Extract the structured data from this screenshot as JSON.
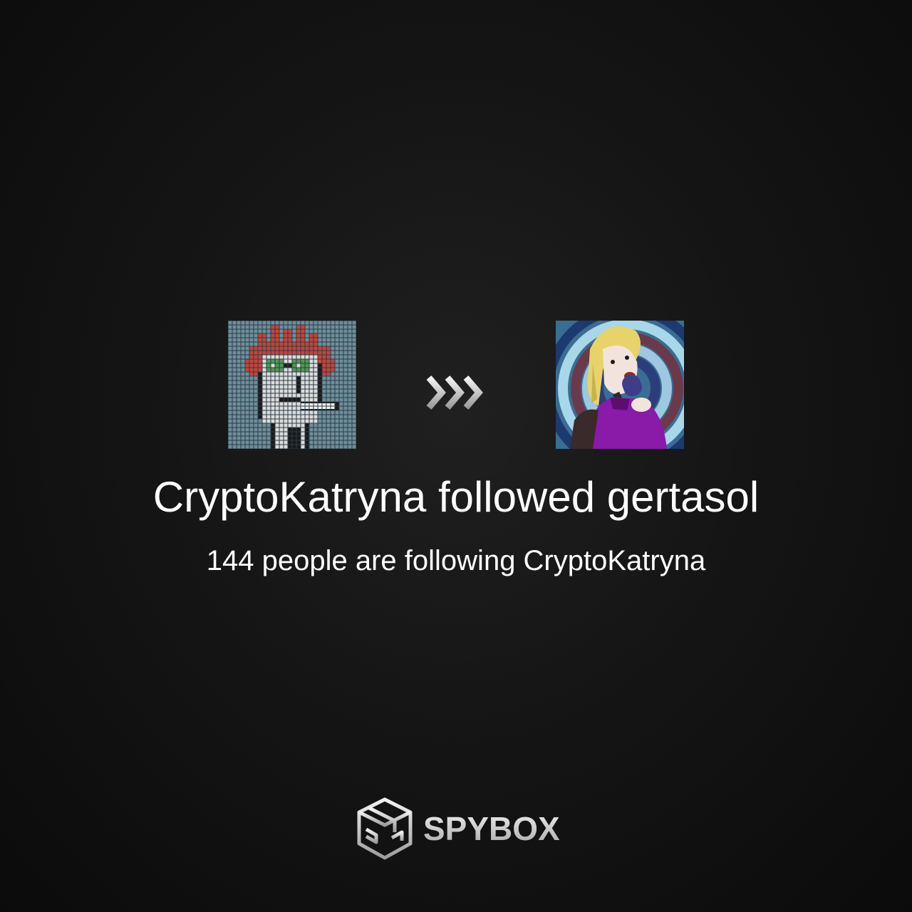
{
  "event": {
    "follower_name": "CryptoKatryna",
    "action_word": "followed",
    "followee_name": "gertasol",
    "follower_count_text": "144 people are following CryptoKatryna"
  },
  "brand": {
    "name": "SPYBOX"
  },
  "icons": {
    "arrow": "triple-chevron-right-icon",
    "logo": "spybox-cube-logo-icon"
  },
  "colors": {
    "text": "#ffffff",
    "brand": "#d8d8d8",
    "followee_outfit": "#8a1aa8"
  }
}
